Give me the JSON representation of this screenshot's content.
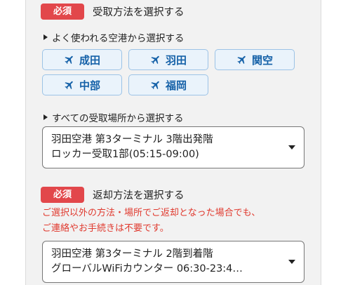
{
  "pickup": {
    "badge": "必須",
    "title": "受取方法を選択する",
    "frequent_label": "よく使われる空港から選択する",
    "airports": [
      "成田",
      "羽田",
      "関空",
      "中部",
      "福岡"
    ],
    "all_label": "すべての受取場所から選択する",
    "selected_line1": "羽田空港 第3ターミナル 3階出発階",
    "selected_line2": "ロッカー受取1部(05:15-09:00)"
  },
  "return": {
    "badge": "必須",
    "title": "返却方法を選択する",
    "notice_line1": "ご選択以外の方法・場所でご返却となった場合でも、",
    "notice_line2": "ご連絡やお手続きは不要です。",
    "selected_line1": "羽田空港 第3ターミナル 2階到着階",
    "selected_line2": "グローバルWiFiカウンター 06:30-23:4…"
  },
  "colors": {
    "badge": "#e2474b",
    "airport_text": "#1561a8",
    "airport_bg": "#eaf3fb",
    "notice": "#e03a2f"
  }
}
